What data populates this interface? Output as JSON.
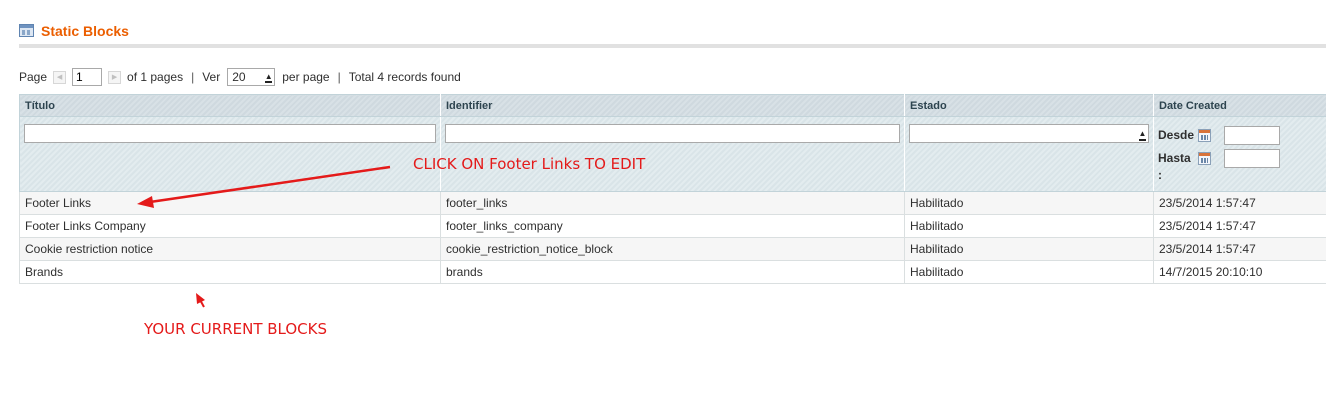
{
  "header": {
    "title": "Static Blocks",
    "icon": "grid-icon"
  },
  "pager": {
    "page_label": "Page",
    "page_value": "1",
    "of_pages": "of 1 pages",
    "sep1": "|",
    "ver_label": "Ver",
    "per_page_value": "20",
    "per_page_label": "per page",
    "sep2": "|",
    "total": "Total 4 records found"
  },
  "grid": {
    "columns": [
      "Título",
      "Identifier",
      "Estado",
      "Date Created"
    ],
    "filters": {
      "desde": "Desde",
      "hasta": "Hasta",
      "colon": ":"
    },
    "rows": [
      {
        "title": "Footer Links",
        "identifier": "footer_links",
        "status": "Habilitado",
        "created": "23/5/2014 1:57:47"
      },
      {
        "title": "Footer Links Company",
        "identifier": "footer_links_company",
        "status": "Habilitado",
        "created": "23/5/2014 1:57:47"
      },
      {
        "title": "Cookie restriction notice",
        "identifier": "cookie_restriction_notice_block",
        "status": "Habilitado",
        "created": "23/5/2014 1:57:47"
      },
      {
        "title": "Brands",
        "identifier": "brands",
        "status": "Habilitado",
        "created": "14/7/2015 20:10:10"
      }
    ]
  },
  "annotations": {
    "click_hint": "CLICK ON Footer Links TO EDIT",
    "blocks_hint": "YOUR CURRENT BLOCKS",
    "color": "#e41a1a"
  }
}
